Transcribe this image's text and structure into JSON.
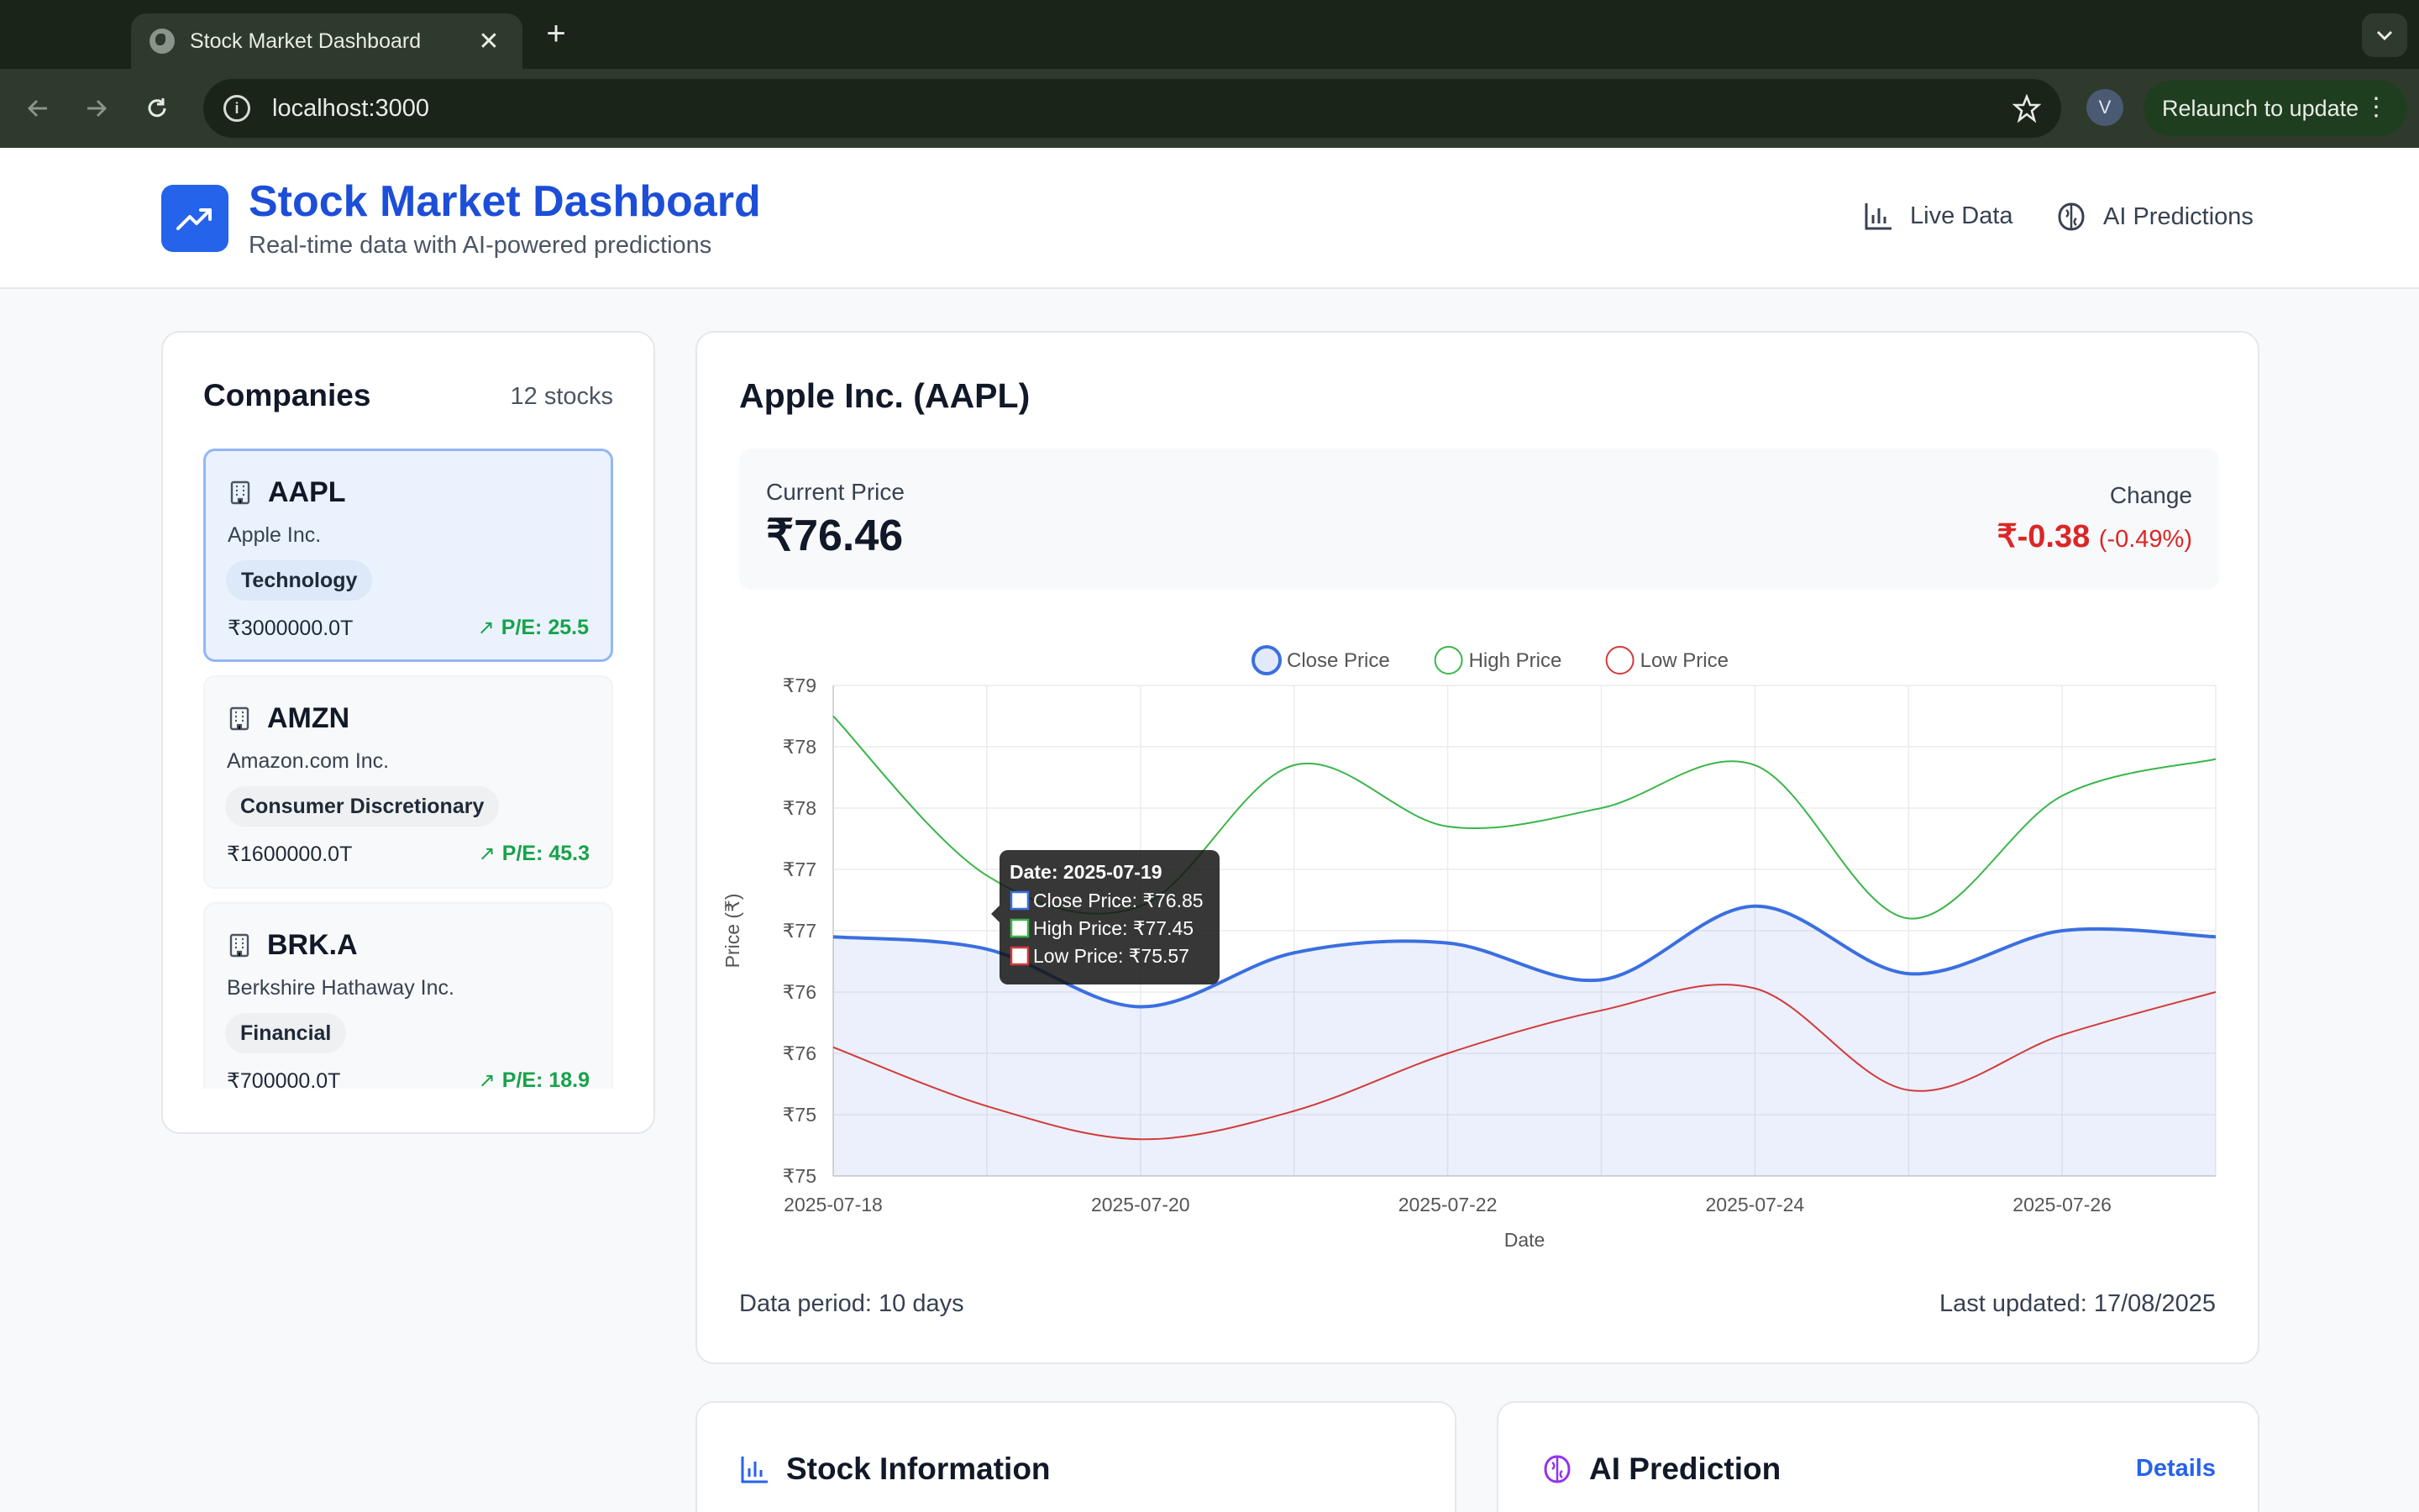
{
  "browser": {
    "tab_title": "Stock Market Dashboard",
    "url": "localhost:3000",
    "profile_initial": "V",
    "relaunch_label": "Relaunch to update"
  },
  "header": {
    "title": "Stock Market Dashboard",
    "subtitle": "Real-time data with AI-powered predictions",
    "nav": [
      "Live Data",
      "AI Predictions"
    ]
  },
  "sidebar": {
    "title": "Companies",
    "count": "12 stocks",
    "companies": [
      {
        "ticker": "AAPL",
        "name": "Apple Inc.",
        "sector": "Technology",
        "market_cap": "₹3000000.0T",
        "pe": "P/E: 25.5",
        "selected": true
      },
      {
        "ticker": "AMZN",
        "name": "Amazon.com Inc.",
        "sector": "Consumer Discretionary",
        "market_cap": "₹1600000.0T",
        "pe": "P/E: 45.3",
        "selected": false
      },
      {
        "ticker": "BRK.A",
        "name": "Berkshire Hathaway Inc.",
        "sector": "Financial",
        "market_cap": "₹700000.0T",
        "pe": "P/E: 18.9",
        "selected": false
      }
    ]
  },
  "stock": {
    "title": "Apple Inc. (AAPL)",
    "current_price_label": "Current Price",
    "current_price": "₹76.46",
    "change_label": "Change",
    "change_value": "₹-0.38",
    "change_pct": "(-0.49%)",
    "data_period": "Data period: 10 days",
    "last_updated": "Last updated: 17/08/2025"
  },
  "chart_data": {
    "type": "line",
    "xlabel": "Date",
    "ylabel": "Price (₹)",
    "ylim": [
      75.0,
      79.0
    ],
    "y_tick_labels": [
      "₹79",
      "₹78",
      "₹78",
      "₹77",
      "₹77",
      "₹76",
      "₹76",
      "₹75",
      "₹75"
    ],
    "x_tick_labels": [
      "2025-07-18",
      "2025-07-20",
      "2025-07-22",
      "2025-07-24",
      "2025-07-26"
    ],
    "x": [
      "2025-07-18",
      "2025-07-19",
      "2025-07-20",
      "2025-07-21",
      "2025-07-22",
      "2025-07-23",
      "2025-07-24",
      "2025-07-25",
      "2025-07-26",
      "2025-07-27"
    ],
    "legend_position": "top",
    "series": [
      {
        "name": "Close Price",
        "color": "#3b6fe0",
        "fill": true,
        "values": [
          76.95,
          76.85,
          76.38,
          76.82,
          76.9,
          76.6,
          77.2,
          76.65,
          77.0,
          76.95
        ]
      },
      {
        "name": "High Price",
        "color": "#3bb54a",
        "fill": false,
        "values": [
          78.75,
          77.45,
          77.2,
          78.35,
          77.85,
          78.0,
          78.35,
          77.1,
          78.1,
          78.4
        ]
      },
      {
        "name": "Low Price",
        "color": "#d33a3a",
        "fill": false,
        "values": [
          76.05,
          75.57,
          75.3,
          75.53,
          76.0,
          76.35,
          76.53,
          75.7,
          76.15,
          76.5
        ]
      }
    ],
    "tooltip": {
      "title": "Date: 2025-07-19",
      "lines": [
        "Close Price: ₹76.85",
        "High Price: ₹77.45",
        "Low Price: ₹75.57"
      ]
    }
  },
  "bottom_cards": {
    "info_title": "Stock Information",
    "prediction_title": "AI Prediction",
    "details_label": "Details"
  },
  "colors": {
    "accent": "#2563eb",
    "positive": "#16a34a",
    "negative": "#dc2626"
  }
}
